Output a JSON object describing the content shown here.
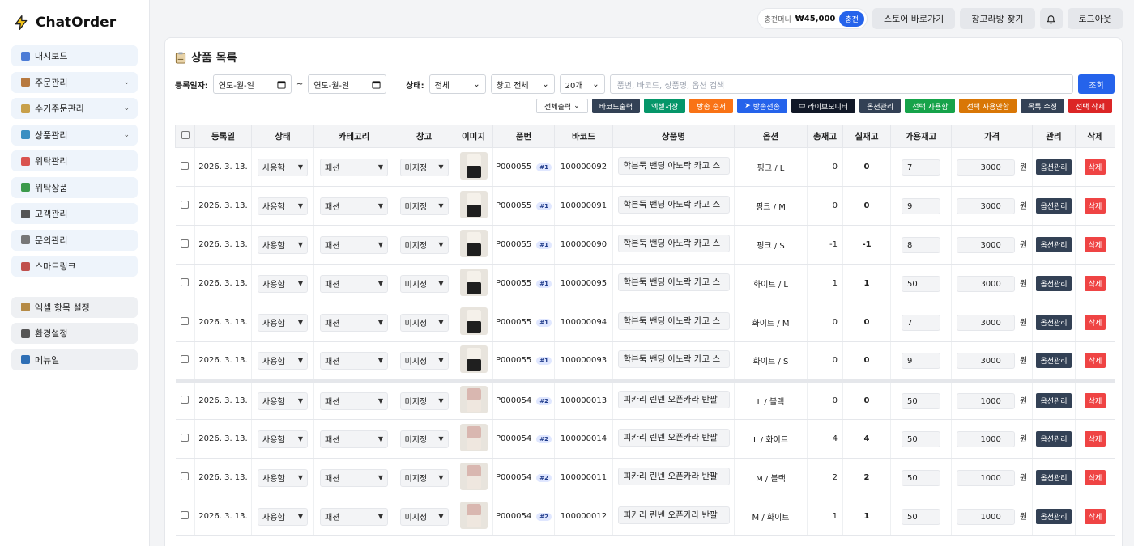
{
  "app": {
    "name": "ChatOrder"
  },
  "sidebar": {
    "items": [
      {
        "label": "대시보드",
        "icon": "chart-icon",
        "color": "#4b7bd6",
        "chevron": false
      },
      {
        "label": "주문관리",
        "icon": "box-icon",
        "color": "#b7793f",
        "chevron": true
      },
      {
        "label": "수기주문관리",
        "icon": "edit-icon",
        "color": "#c8a04a",
        "chevron": true
      },
      {
        "label": "상품관리",
        "icon": "tag-icon",
        "color": "#3a8fc2",
        "chevron": true
      },
      {
        "label": "위탁관리",
        "icon": "truck-icon",
        "color": "#d9534f",
        "chevron": false
      },
      {
        "label": "위탁상품",
        "icon": "puzzle-icon",
        "color": "#3c9a4b",
        "chevron": false
      },
      {
        "label": "고객관리",
        "icon": "users-icon",
        "color": "#555555",
        "chevron": false
      },
      {
        "label": "문의관리",
        "icon": "chat-icon",
        "color": "#777777",
        "chevron": false
      },
      {
        "label": "스마트링크",
        "icon": "link-chart-icon",
        "color": "#c0504d",
        "chevron": false
      }
    ],
    "bottom_items": [
      {
        "label": "엑셀 항목 설정",
        "icon": "clipboard-icon",
        "color": "#b58a45"
      },
      {
        "label": "환경설정",
        "icon": "gear-icon",
        "color": "#555555"
      },
      {
        "label": "메뉴얼",
        "icon": "book-icon",
        "color": "#2f6fb5"
      }
    ]
  },
  "topbar": {
    "money_label": "충전머니",
    "money_amount": "₩45,000",
    "charge_label": "충전",
    "store_label": "스토어 바로가기",
    "warehouse_label": "창고라방 찾기",
    "logout_label": "로그아웃"
  },
  "panel": {
    "title": "상품 목록",
    "filter": {
      "date_label": "등록일자:",
      "date_from": "연도-월-일",
      "date_sep": "~",
      "date_to": "연도-월-일",
      "status_label": "상태:",
      "status_value": "전체",
      "warehouse_value": "창고 전체",
      "page_size_value": "20개",
      "search_placeholder": "품번, 바코드, 상품명, 옵션 검색",
      "search_button": "조회"
    },
    "actions": [
      {
        "label": "전체출력",
        "color": "#ffffff",
        "kind": "select"
      },
      {
        "label": "바코드출력",
        "color": "#334155"
      },
      {
        "label": "엑셀저장",
        "color": "#059669"
      },
      {
        "label": "방송 순서",
        "color": "#f97316"
      },
      {
        "label": "방송전송",
        "color": "#2563eb",
        "icon": "cursor-icon"
      },
      {
        "label": "라이브모니터",
        "color": "#111827",
        "icon": "monitor-icon"
      },
      {
        "label": "옵션관리",
        "color": "#334155"
      },
      {
        "label": "선택 사용함",
        "color": "#16a34a"
      },
      {
        "label": "선택 사용안함",
        "color": "#d97706"
      },
      {
        "label": "목록 수정",
        "color": "#334155"
      },
      {
        "label": "선택 삭제",
        "color": "#dc2626"
      }
    ]
  },
  "table": {
    "headers": [
      "",
      "등록일",
      "상태",
      "카테고리",
      "창고",
      "이미지",
      "품번",
      "바코드",
      "상품명",
      "옵션",
      "총재고",
      "실재고",
      "가용재고",
      "가격",
      "관리",
      "삭제"
    ],
    "status_options_selected": "사용함",
    "category_selected": "패션",
    "warehouse_selected": "미지정",
    "currency_unit": "원",
    "option_button": "옵션관리",
    "delete_button": "삭제",
    "rows": [
      {
        "date": "2026. 3. 13.",
        "code": "P000055",
        "badge": "#1",
        "barcode": "100000092",
        "name": "학븐둑 밴딩 아노락 카고 스",
        "option": "핑크 / L",
        "total": "0",
        "real": "0",
        "avail": "7",
        "price": "3000",
        "thumb": "dark",
        "gap": false
      },
      {
        "date": "2026. 3. 13.",
        "code": "P000055",
        "badge": "#1",
        "barcode": "100000091",
        "name": "학븐둑 밴딩 아노락 카고 스",
        "option": "핑크 / M",
        "total": "0",
        "real": "0",
        "avail": "9",
        "price": "3000",
        "thumb": "dark",
        "gap": false
      },
      {
        "date": "2026. 3. 13.",
        "code": "P000055",
        "badge": "#1",
        "barcode": "100000090",
        "name": "학븐둑 밴딩 아노락 카고 스",
        "option": "핑크 / S",
        "total": "-1",
        "real": "-1",
        "avail": "8",
        "price": "3000",
        "thumb": "dark",
        "gap": false
      },
      {
        "date": "2026. 3. 13.",
        "code": "P000055",
        "badge": "#1",
        "barcode": "100000095",
        "name": "학븐둑 밴딩 아노락 카고 스",
        "option": "화이트 / L",
        "total": "1",
        "real": "1",
        "avail": "50",
        "price": "3000",
        "thumb": "dark",
        "gap": false
      },
      {
        "date": "2026. 3. 13.",
        "code": "P000055",
        "badge": "#1",
        "barcode": "100000094",
        "name": "학븐둑 밴딩 아노락 카고 스",
        "option": "화이트 / M",
        "total": "0",
        "real": "0",
        "avail": "7",
        "price": "3000",
        "thumb": "dark",
        "gap": false
      },
      {
        "date": "2026. 3. 13.",
        "code": "P000055",
        "badge": "#1",
        "barcode": "100000093",
        "name": "학븐둑 밴딩 아노락 카고 스",
        "option": "화이트 / S",
        "total": "0",
        "real": "0",
        "avail": "9",
        "price": "3000",
        "thumb": "dark",
        "gap": false
      },
      {
        "date": "2026. 3. 13.",
        "code": "P000054",
        "badge": "#2",
        "barcode": "100000013",
        "name": "피카리 린넨 오픈카라 반팔",
        "option": "L / 블랙",
        "total": "0",
        "real": "0",
        "avail": "50",
        "price": "1000",
        "thumb": "pink",
        "gap": true
      },
      {
        "date": "2026. 3. 13.",
        "code": "P000054",
        "badge": "#2",
        "barcode": "100000014",
        "name": "피카리 린넨 오픈카라 반팔",
        "option": "L / 화이트",
        "total": "4",
        "real": "4",
        "avail": "50",
        "price": "1000",
        "thumb": "pink",
        "gap": false
      },
      {
        "date": "2026. 3. 13.",
        "code": "P000054",
        "badge": "#2",
        "barcode": "100000011",
        "name": "피카리 린넨 오픈카라 반팔",
        "option": "M / 블랙",
        "total": "2",
        "real": "2",
        "avail": "50",
        "price": "1000",
        "thumb": "pink",
        "gap": false
      },
      {
        "date": "2026. 3. 13.",
        "code": "P000054",
        "badge": "#2",
        "barcode": "100000012",
        "name": "피카리 린넨 오픈카라 반팔",
        "option": "M / 화이트",
        "total": "1",
        "real": "1",
        "avail": "50",
        "price": "1000",
        "thumb": "pink",
        "gap": false
      }
    ]
  }
}
